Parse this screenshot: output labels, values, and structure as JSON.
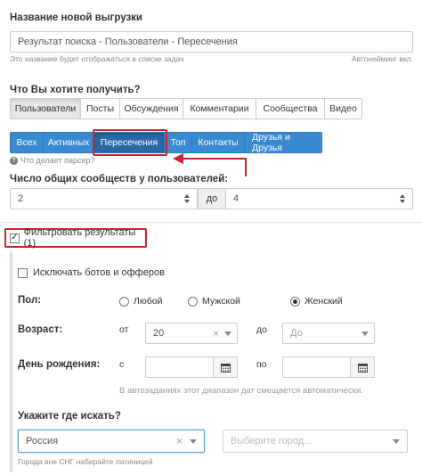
{
  "export_name": {
    "label": "Название новой выгрузки",
    "value": "Результат поиска - Пользователи - Пересечения",
    "hint": "Это название будет отображаться в списке задач",
    "auto_hint": "Автонейминг вкл."
  },
  "what_to_get": {
    "label": "Что Вы хотите получить?",
    "tabs": [
      "Пользователи",
      "Посты",
      "Обсуждения",
      "Комментарии",
      "Сообщества",
      "Видео"
    ],
    "active_tab": "Пользователи"
  },
  "parser_tabs": {
    "tabs": [
      "Всех",
      "Активных",
      "Пересечения",
      "Топ",
      "Контакты",
      "Друзья и Друзья"
    ],
    "active_tab": "Пересечения",
    "help_link": "Что делает парсер?"
  },
  "common_groups": {
    "label": "Число общих сообществ у пользователей:",
    "from_value": "2",
    "to_label": "до",
    "to_value": "4"
  },
  "filter": {
    "label": "Фильтровать результаты (1)",
    "checked": true,
    "exclude_bots_label": "Исключать ботов и офферов",
    "gender": {
      "label": "Пол:",
      "options": [
        "Любой",
        "Мужской",
        "Женский"
      ],
      "selected": "Женский"
    },
    "age": {
      "label": "Возраст:",
      "from_label": "от",
      "from_value": "20",
      "to_label": "до",
      "to_placeholder": "До"
    },
    "birthday": {
      "label": "День рождения:",
      "from_label": "с",
      "to_label": "по",
      "hint": "В автозаданиях этот диапазон дат смещается автоматически."
    },
    "location": {
      "label": "Укажите где искать?",
      "country_value": "Россия",
      "city_placeholder": "Выберите город...",
      "hint": "Города вне СНГ набирайте латиницей"
    }
  },
  "colors": {
    "accent_blue": "#3a8ad2",
    "highlight_red": "#c8262c"
  }
}
